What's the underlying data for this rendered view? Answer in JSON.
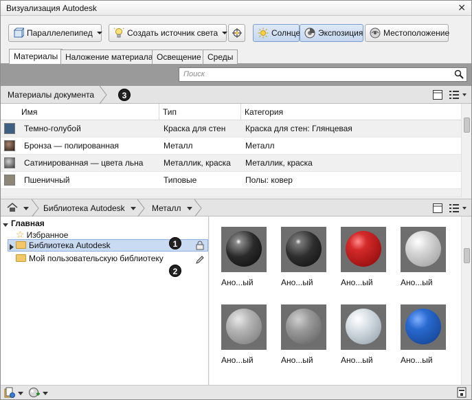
{
  "window": {
    "title": "Визуализация Autodesk"
  },
  "toolbar": {
    "box_label": "Параллелепипед",
    "light_label": "Создать источник света",
    "sun_label": "Солнце",
    "exposure_label": "Экспозиция",
    "location_label": "Местоположение"
  },
  "tabs": [
    {
      "label": "Материалы"
    },
    {
      "label": "Наложение материала"
    },
    {
      "label": "Освещение"
    },
    {
      "label": "Среды"
    }
  ],
  "search": {
    "placeholder": "Поиск"
  },
  "doc_breadcrumb": {
    "label": "Материалы документа",
    "callout": "3"
  },
  "table": {
    "headers": [
      "Имя",
      "Тип",
      "Категория"
    ],
    "rows": [
      {
        "name": "Темно-голубой",
        "type": "Краска для стен",
        "category": "Краска для стен: Глянцевая",
        "swatch": "#3f5f82"
      },
      {
        "name": "Бронза — полированная",
        "type": "Металл",
        "category": "Металл",
        "swatch": "#4a3a30"
      },
      {
        "name": "Сатинированная — цвета льна",
        "type": "Металлик, краска",
        "category": "Металлик, краска",
        "swatch": "#6a6a6a"
      },
      {
        "name": "Пшеничный",
        "type": "Типовые",
        "category": "Полы: ковер",
        "swatch": "#8e8676"
      }
    ]
  },
  "library_nav": {
    "crumb1": "Библиотека Autodesk",
    "crumb2": "Металл"
  },
  "tree": {
    "root": "Главная",
    "favorites": "Избранное",
    "autodesk_lib": "Библиотека Autodesk",
    "user_lib": "Мой пользовательскую библиотеку",
    "callout1": "1",
    "callout2": "2"
  },
  "materials": [
    {
      "label": "Ано...ый",
      "color": "#2a2a2a"
    },
    {
      "label": "Ано...ый",
      "color": "#2e2e2e"
    },
    {
      "label": "Ано...ый",
      "color": "#c82020"
    },
    {
      "label": "Ано...ый",
      "color": "#cfcfcf"
    },
    {
      "label": "Ано...ый",
      "color": "#a8a8a8"
    },
    {
      "label": "Ано...ый",
      "color": "#8a8a8a"
    },
    {
      "label": "Ано...ый",
      "color": "#c9d3da"
    },
    {
      "label": "Ано...ый",
      "color": "#1f5fbf"
    }
  ],
  "icons": [
    "close-icon",
    "box-icon",
    "light-icon",
    "target-icon",
    "sun-icon",
    "exposure-icon",
    "location-icon",
    "search-icon",
    "tile-view-icon",
    "list-view-icon",
    "home-icon",
    "star-icon",
    "folder-icon",
    "lock-icon",
    "pencil-icon",
    "library-icon",
    "material-browser-icon",
    "panel-icon"
  ]
}
